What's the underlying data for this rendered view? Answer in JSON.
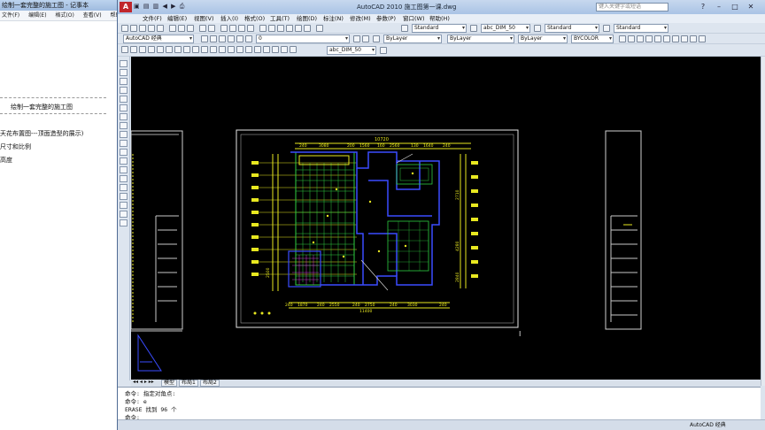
{
  "notepad": {
    "title": "绘制一套完整的施工图 - 记事本",
    "menu": [
      "文件(F)",
      "编辑(E)",
      "格式(O)",
      "查看(V)",
      "帮助(H)"
    ],
    "lines": [
      "绘制一套完整的施工图",
      "天花布置图---顶面造型的展示)",
      "尺寸和比例",
      "高度"
    ]
  },
  "autocad": {
    "title": "AutoCAD 2010    施工图第一课.dwg",
    "search_placeholder": "键入关键字或短语",
    "menu": [
      "文件(F)",
      "编辑(E)",
      "视图(V)",
      "插入(I)",
      "格式(O)",
      "工具(T)",
      "绘图(D)",
      "标注(N)",
      "修改(M)",
      "参数(P)",
      "窗口(W)",
      "帮助(H)"
    ],
    "toolbar": {
      "text_style": "Standard",
      "dim_style": "abc_DIM_50",
      "table_style": "Standard",
      "multileader_style": "Standard",
      "workspace": "AutoCAD 经典",
      "layer": "0",
      "color": "ByLayer",
      "linetype": "ByLayer",
      "lineweight": "ByLayer",
      "plotstyle": "BYCOLOR",
      "dim_style2": "abc_DIM_50"
    },
    "layout_tabs": [
      "模型",
      "布局1",
      "布局2"
    ],
    "command_lines": [
      "命令: 指定对角点:",
      "命令: e",
      "ERASE 找到 96 个",
      "命令:"
    ],
    "status_workspace": "AutoCAD 经典"
  },
  "plan": {
    "top_total": "10720",
    "top_dims": [
      "240",
      "3080",
      "200",
      "1560",
      "160",
      "2560",
      "130",
      "1640",
      "240"
    ],
    "bottom_dims": [
      "240",
      "1870",
      "240",
      "2550",
      "240",
      "2750",
      "240",
      "3030",
      "240"
    ],
    "bottom_total": "11400",
    "right_dims": [
      "2710",
      "4280",
      "2840"
    ],
    "left_dim": "2500"
  },
  "colors": {
    "wall_blue": "#3a4cff",
    "dim_yellow": "#e8e820",
    "tile_green": "#2ecc40",
    "frame_white": "#e6e6e6",
    "accent": "#c0262c"
  }
}
